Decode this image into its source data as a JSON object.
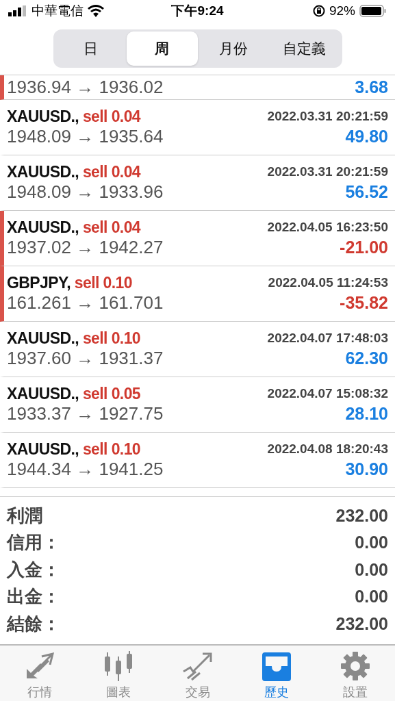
{
  "status_bar": {
    "carrier": "中華電信",
    "time": "下午9:24",
    "battery": "92%"
  },
  "segments": [
    {
      "label": "日",
      "selected": false
    },
    {
      "label": "周",
      "selected": true
    },
    {
      "label": "月份",
      "selected": false
    },
    {
      "label": "自定義",
      "selected": false
    }
  ],
  "partial_row": {
    "prices": "1936.94 → 1936.02",
    "profit": "3.68",
    "negative": false,
    "marked": true
  },
  "trades": [
    {
      "symbol": "XAUUSD.,",
      "order": "sell 0.04",
      "time": "2022.03.31 20:21:59",
      "prices": "1948.09 → 1935.64",
      "profit": "49.80",
      "negative": false,
      "marked": false
    },
    {
      "symbol": "XAUUSD.,",
      "order": "sell 0.04",
      "time": "2022.03.31 20:21:59",
      "prices": "1948.09 → 1933.96",
      "profit": "56.52",
      "negative": false,
      "marked": false
    },
    {
      "symbol": "XAUUSD.,",
      "order": "sell 0.04",
      "time": "2022.04.05 16:23:50",
      "prices": "1937.02 → 1942.27",
      "profit": "-21.00",
      "negative": true,
      "marked": true
    },
    {
      "symbol": "GBPJPY,",
      "order": "sell 0.10",
      "time": "2022.04.05 11:24:53",
      "prices": "161.261 → 161.701",
      "profit": "-35.82",
      "negative": true,
      "marked": true
    },
    {
      "symbol": "XAUUSD.,",
      "order": "sell 0.10",
      "time": "2022.04.07 17:48:03",
      "prices": "1937.60 → 1931.37",
      "profit": "62.30",
      "negative": false,
      "marked": false
    },
    {
      "symbol": "XAUUSD.,",
      "order": "sell 0.05",
      "time": "2022.04.07 15:08:32",
      "prices": "1933.37 → 1927.75",
      "profit": "28.10",
      "negative": false,
      "marked": false
    },
    {
      "symbol": "XAUUSD.,",
      "order": "sell 0.10",
      "time": "2022.04.08 18:20:43",
      "prices": "1944.34 → 1941.25",
      "profit": "30.90",
      "negative": false,
      "marked": false
    }
  ],
  "summary": [
    {
      "label": "利潤",
      "value": "232.00"
    },
    {
      "label": "信用：",
      "value": "0.00"
    },
    {
      "label": "入金：",
      "value": "0.00"
    },
    {
      "label": "出金：",
      "value": "0.00"
    },
    {
      "label": "結餘：",
      "value": "232.00"
    }
  ],
  "tab_bar": [
    {
      "kind": "quotes",
      "label": "行情",
      "selected": false
    },
    {
      "kind": "chart",
      "label": "圖表",
      "selected": false
    },
    {
      "kind": "trade",
      "label": "交易",
      "selected": false
    },
    {
      "kind": "history",
      "label": "歷史",
      "selected": true
    },
    {
      "kind": "settings",
      "label": "設置",
      "selected": false
    }
  ]
}
